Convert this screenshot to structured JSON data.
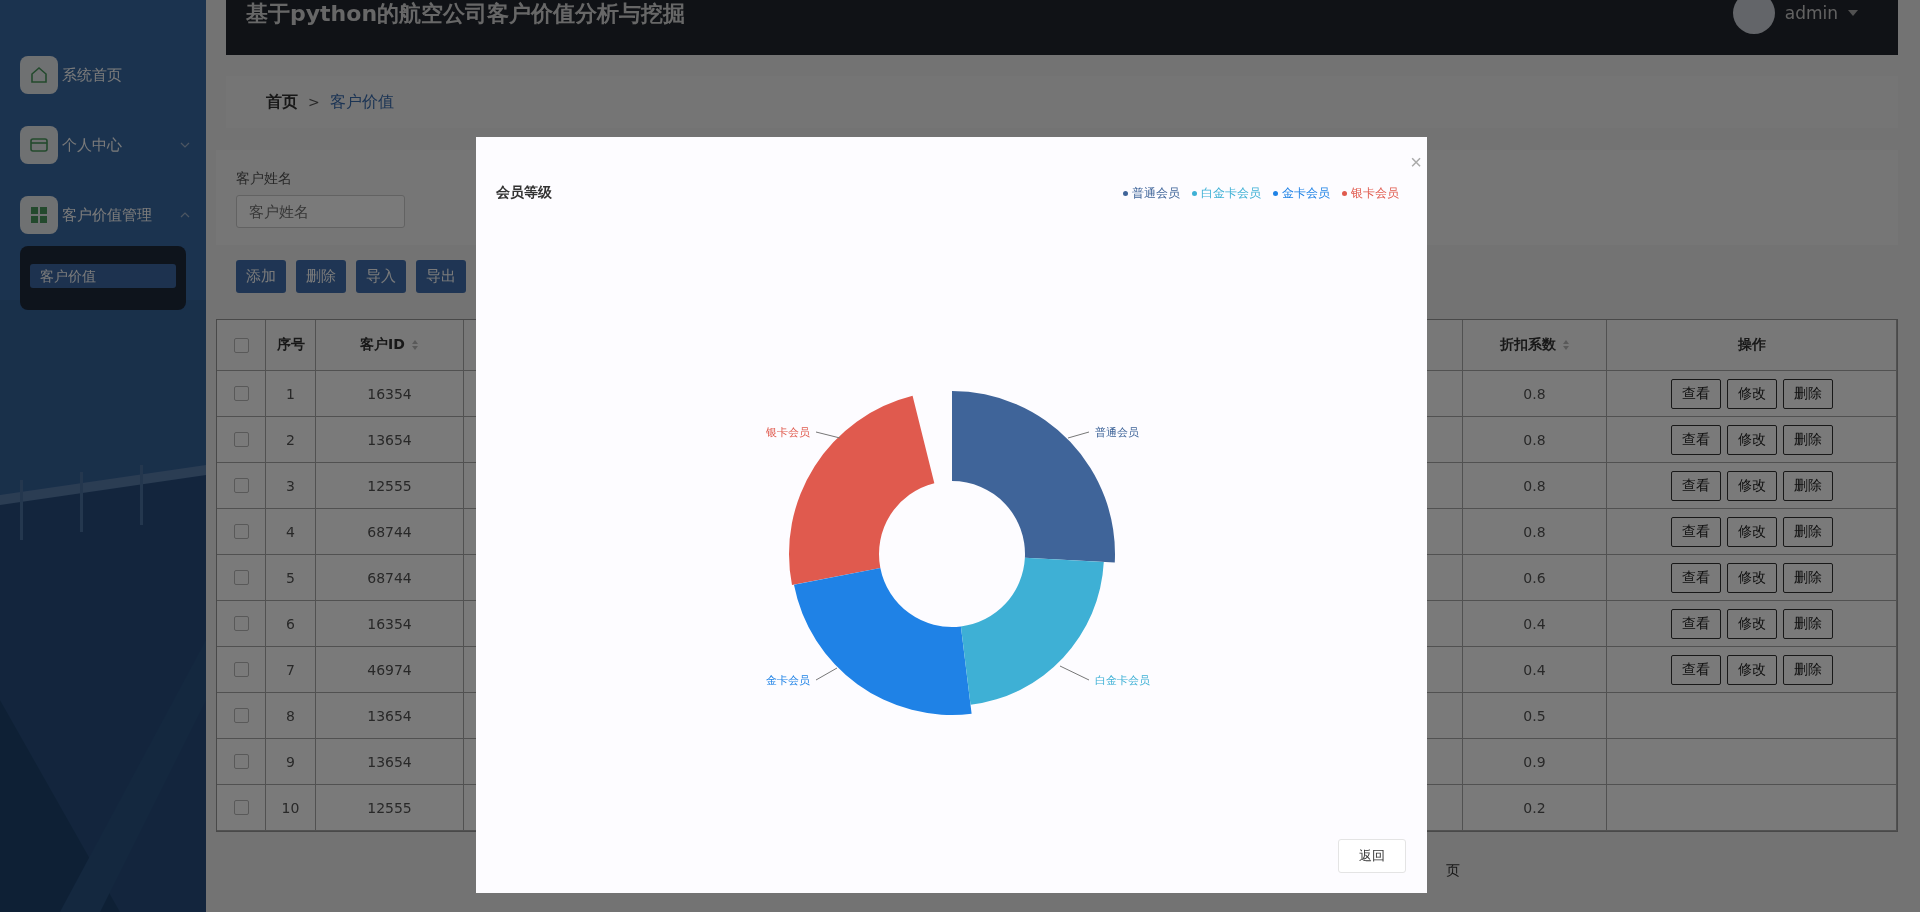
{
  "header": {
    "title": "基于python的航空公司客户价值分析与挖掘",
    "user": "admin"
  },
  "sidebar": {
    "items": [
      {
        "label": "系统首页"
      },
      {
        "label": "个人中心",
        "expanded": false
      },
      {
        "label": "客户价值管理",
        "expanded": true,
        "children": [
          {
            "label": "客户价值",
            "selected": true
          }
        ]
      }
    ]
  },
  "breadcrumb": {
    "home": "首页",
    "separator": ">",
    "current": "客户价值"
  },
  "search": {
    "label": "客户姓名",
    "placeholder": "客户姓名"
  },
  "toolbar": [
    "添加",
    "删除",
    "导入",
    "导出"
  ],
  "table": {
    "select_all_checked": false,
    "columns": [
      {
        "label": "序号",
        "kind": "plain"
      },
      {
        "label": "客户ID",
        "kind": "sortable"
      },
      {
        "label": "折扣系数",
        "kind": "sortable"
      },
      {
        "label": "操作",
        "kind": "plain"
      }
    ],
    "rows": [
      {
        "checked": false,
        "index": "1",
        "id": "16354",
        "discount": "0.8",
        "actions": [
          "查看",
          "修改",
          "删除"
        ]
      },
      {
        "checked": false,
        "index": "2",
        "id": "13654",
        "discount": "0.8",
        "actions": [
          "查看",
          "修改",
          "删除"
        ]
      },
      {
        "checked": false,
        "index": "3",
        "id": "12555",
        "discount": "0.8",
        "actions": [
          "查看",
          "修改",
          "删除"
        ]
      },
      {
        "checked": false,
        "index": "4",
        "id": "68744",
        "discount": "0.8",
        "actions": [
          "查看",
          "修改",
          "删除"
        ]
      },
      {
        "checked": false,
        "index": "5",
        "id": "68744",
        "discount": "0.6",
        "actions": [
          "查看",
          "修改",
          "删除"
        ]
      },
      {
        "checked": false,
        "index": "6",
        "id": "16354",
        "discount": "0.4",
        "actions": [
          "查看",
          "修改",
          "删除"
        ]
      },
      {
        "checked": false,
        "index": "7",
        "id": "46974",
        "discount": "0.4",
        "actions": [
          "查看",
          "修改",
          "删除"
        ]
      },
      {
        "checked": false,
        "index": "8",
        "id": "13654",
        "discount": "0.5",
        "actions": []
      },
      {
        "checked": false,
        "index": "9",
        "id": "13654",
        "discount": "0.9",
        "actions": []
      },
      {
        "checked": false,
        "index": "10",
        "id": "12555",
        "discount": "0.2",
        "actions": []
      }
    ]
  },
  "pagination": {
    "text": "页"
  },
  "dialog": {
    "close": "×",
    "title": "会员等级",
    "legend": [
      {
        "label": "普通会员",
        "color": "#3f6499"
      },
      {
        "label": "白金卡会员",
        "color": "#3eb0d5"
      },
      {
        "label": "金卡会员",
        "color": "#1f82e6"
      },
      {
        "label": "银卡会员",
        "color": "#e05a4e"
      }
    ],
    "slices": [
      {
        "label": "银卡会员",
        "color": "#e05a4e"
      },
      {
        "label": "普通会员",
        "color": "#3f6499"
      },
      {
        "label": "金卡会员",
        "color": "#1f82e6"
      },
      {
        "label": "白金卡会员",
        "color": "#3eb0d5"
      }
    ],
    "button": "返回"
  }
}
